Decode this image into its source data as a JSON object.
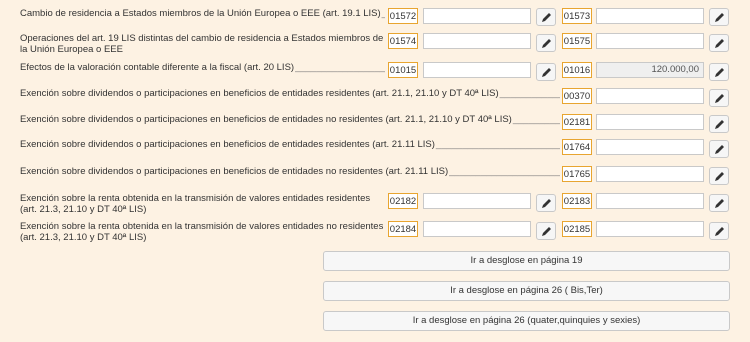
{
  "rows": [
    {
      "label": "Cambio de residencia a Estados miembros de la Unión Europea o EEE (art. 19.1 LIS)",
      "code1": "01572",
      "value1": "",
      "code2": "01573",
      "value2": ""
    },
    {
      "label": "Operaciones del art. 19 LIS distintas del cambio de residencia a Estados miembros de la Unión Europea o EEE",
      "code1": "01574",
      "value1": "",
      "code2": "01575",
      "value2": ""
    },
    {
      "label": "Efectos de la valoración contable diferente a la fiscal (art. 20 LIS)",
      "code1": "01015",
      "value1": "",
      "code2": "01016",
      "value2": "120.000,00"
    },
    {
      "label": "Exención sobre dividendos o participaciones en beneficios de entidades residentes (art. 21.1, 21.10 y DT 40ª LIS)",
      "code2": "00370",
      "value2": ""
    },
    {
      "label": "Exención sobre dividendos o participaciones en beneficios de entidades no residentes (art. 21.1, 21.10 y DT 40ª LIS)",
      "code2": "02181",
      "value2": ""
    },
    {
      "label": "Exención sobre dividendos o participaciones en beneficios de entidades residentes (art. 21.11 LIS)",
      "code2": "01764",
      "value2": ""
    },
    {
      "label": "Exención sobre dividendos o participaciones en beneficios de entidades no residentes (art. 21.11 LIS)",
      "code2": "01765",
      "value2": ""
    },
    {
      "label": "Exención sobre la renta obtenida en la transmisión de valores entidades residentes (art. 21.3, 21.10 y DT 40ª LIS)",
      "code1": "02182",
      "value1": "",
      "code2": "02183",
      "value2": ""
    },
    {
      "label": "Exención sobre la renta obtenida en la transmisión de valores entidades no residentes (art. 21.3, 21.10 y DT 40ª LIS)",
      "code1": "02184",
      "value1": "",
      "code2": "02185",
      "value2": ""
    }
  ],
  "buttons": {
    "pagina19": "Ir a desglose en página 19",
    "pagina26bis": "Ir a desglose en página 26 ( Bis,Ter)",
    "pagina26quater": "Ir a desglose en página 26 (quater,quinquies y sexies)"
  },
  "icons": {
    "edit": "pencil-icon"
  }
}
